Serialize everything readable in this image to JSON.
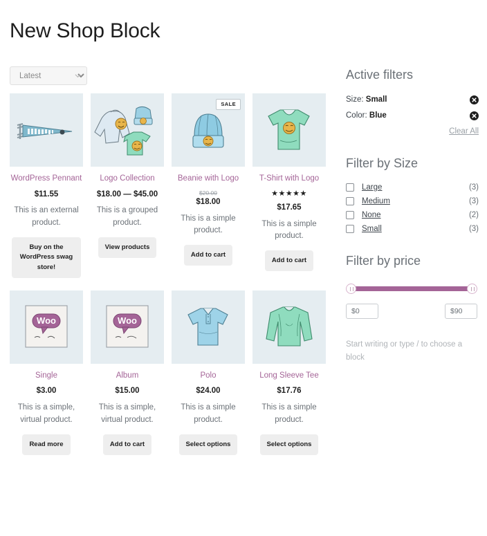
{
  "page": {
    "title": "New Shop Block"
  },
  "toolbar": {
    "sort_value": "Latest",
    "sort_caret_icon": "chevron-down-icon"
  },
  "products": [
    {
      "title": "WordPress Pennant",
      "price": "$11.55",
      "old_price": "",
      "rating": "",
      "description": "This is an external product.",
      "button": "Buy on the WordPress swag store!",
      "badge": "",
      "image": "pennant"
    },
    {
      "title": "Logo Collection",
      "price": "$18.00 — $45.00",
      "old_price": "",
      "rating": "",
      "description": "This is a grouped product.",
      "button": "View products",
      "badge": "",
      "image": "logo-collection"
    },
    {
      "title": "Beanie with Logo",
      "price": "$18.00",
      "old_price": "$20.00",
      "rating": "",
      "description": "This is a simple product.",
      "button": "Add to cart",
      "badge": "SALE",
      "image": "beanie"
    },
    {
      "title": "T-Shirt with Logo",
      "price": "$17.65",
      "old_price": "",
      "rating": "★★★★★",
      "description": "This is a simple product.",
      "button": "Add to cart",
      "badge": "",
      "image": "tshirt"
    },
    {
      "title": "Single",
      "price": "$3.00",
      "old_price": "",
      "rating": "",
      "description": "This is a simple, virtual product.",
      "button": "Read more",
      "badge": "",
      "image": "woo-single"
    },
    {
      "title": "Album",
      "price": "$15.00",
      "old_price": "",
      "rating": "",
      "description": "This is a simple, virtual product.",
      "button": "Add to cart",
      "badge": "",
      "image": "woo-album"
    },
    {
      "title": "Polo",
      "price": "$24.00",
      "old_price": "",
      "rating": "",
      "description": "This is a simple product.",
      "button": "Select options",
      "badge": "",
      "image": "polo"
    },
    {
      "title": "Long Sleeve Tee",
      "price": "$17.76",
      "old_price": "",
      "rating": "",
      "description": "This is a simple product.",
      "button": "Select options",
      "badge": "",
      "image": "long-sleeve"
    }
  ],
  "sidebar": {
    "active_filters": {
      "heading": "Active filters",
      "items": [
        {
          "label": "Size:",
          "value": "Small",
          "remove_icon": "close-circle-icon"
        },
        {
          "label": "Color:",
          "value": "Blue",
          "remove_icon": "close-circle-icon"
        }
      ],
      "clear_all": "Clear All"
    },
    "filter_by_size": {
      "heading": "Filter by Size",
      "options": [
        {
          "label": "Large",
          "count": "(3)",
          "checked": false
        },
        {
          "label": "Medium",
          "count": "(3)",
          "checked": false
        },
        {
          "label": "None",
          "count": "(2)",
          "checked": false
        },
        {
          "label": "Small",
          "count": "(3)",
          "checked": false
        }
      ]
    },
    "filter_by_price": {
      "heading": "Filter by price",
      "min_value": "$0",
      "max_value": "$90",
      "min_placeholder": "$0",
      "max_placeholder": "$90",
      "track_color": "#a46497"
    },
    "block_hint": "Start writing or type / to choose a block"
  },
  "colors": {
    "accent": "#a46497",
    "thumb_bg": "#e5edf1",
    "text": "#3c434a",
    "muted": "#6b7177"
  }
}
